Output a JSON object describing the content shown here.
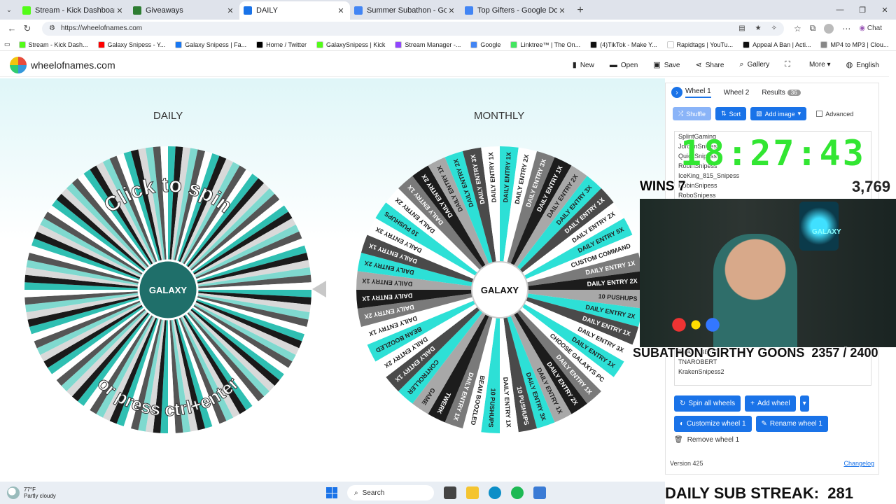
{
  "browser": {
    "tabs": [
      {
        "label": "Stream - Kick Dashboard",
        "color": "#53fc18",
        "active": false
      },
      {
        "label": "Giveaways",
        "color": "#2e7d32",
        "active": false
      },
      {
        "label": "DAILY",
        "color": "#1a73e8",
        "active": true
      },
      {
        "label": "Summer Subathon - Google Docs",
        "color": "#4285f4",
        "active": false
      },
      {
        "label": "Top Gifters - Google Docs",
        "color": "#4285f4",
        "active": false
      }
    ],
    "url": "https://wheelofnames.com",
    "chat_label": "Chat",
    "bookmarks": [
      {
        "label": "Stream - Kick Dash...",
        "color": "#53fc18"
      },
      {
        "label": "Galaxy Snipess - Y...",
        "color": "#ff0000"
      },
      {
        "label": "Galaxy Snipess | Fa...",
        "color": "#1877f2"
      },
      {
        "label": "Home / Twitter",
        "color": "#000000"
      },
      {
        "label": "GalaxySnipess | Kick",
        "color": "#53fc18"
      },
      {
        "label": "Stream Manager -...",
        "color": "#9146ff"
      },
      {
        "label": "Google",
        "color": "#4285f4"
      },
      {
        "label": "Linktree™ | The On...",
        "color": "#43e660"
      },
      {
        "label": "(4)TikTok - Make Y...",
        "color": "#111111"
      },
      {
        "label": "Rapidtags | YouTu...",
        "color": "#ffffff"
      },
      {
        "label": "Appeal A Ban | Acti...",
        "color": "#111111"
      },
      {
        "label": "MP4 to MP3 | Clou...",
        "color": "#888888"
      }
    ]
  },
  "site": {
    "logo": "wheelofnames.com",
    "nav": {
      "new": "New",
      "open": "Open",
      "save": "Save",
      "share": "Share",
      "gallery": "Gallery",
      "more": "More",
      "language": "English"
    }
  },
  "wheels": {
    "daily": {
      "title": "DAILY",
      "line1": "Click to spin",
      "line2": "or press ctrl+enter",
      "logo_text": "GALAXY",
      "colors": [
        "#2fbfb2",
        "#1a1a1a",
        "#d9d9d9",
        "#7fd9cf",
        "#555555",
        "#ffffff"
      ]
    },
    "monthly": {
      "title": "MONTHLY",
      "logo_text": "GALAXY",
      "segments": [
        "DAILY ENTRY 1X",
        "DAILY ENTRY 2X",
        "DAILY ENTRY 3X",
        "DAILY ENTRY 1X",
        "DAILY ENTRY 2X",
        "DAILY ENTRY 3X",
        "DAILY ENTRY 1X",
        "DAILY ENTRY 2X",
        "DAILY ENTRY 5X",
        "CUSTOM COMMAND",
        "DAILY ENTRY 1X",
        "DAILY ENTRY 2X",
        "10 PUSHUPS",
        "DAILY ENTRY 2X",
        "DAILY ENTRY 1X",
        "DAILY ENTRY 3X",
        "DAILY ENTRY 1X",
        "CHOOSE GALAXYS PC",
        "DAILY ENTRY 1X",
        "DAILY ENTRY 2X",
        "DAILY ENTRY 1X",
        "DAILY ENTRY 3X",
        "10 PUSHUPS",
        "DAILY ENTRY 1X",
        "10 PUSHUPS",
        "BEAN BOOZLED",
        "DAILY ENTRY 1X",
        "TWERK",
        "GAME",
        "CONTROLLER",
        "DAILY ENTRY 1X",
        "DAILY ENTRY 2X",
        "BEAN BOOZLED",
        "DAILY ENTRY 1X",
        "DAILY ENTRY 2X",
        "DAILY ENTRY 1X",
        "DAILY ENTRY 1X",
        "DAILY ENTRY 2X",
        "DAILY ENTRY 1X",
        "DAILY ENTRY 3X",
        "10 PUSHUPS",
        "DAILY ENTRY 2X",
        "DAILY ENTRY 1X",
        "DAILY ENTRY 2X",
        "DAILY ENTRY 1X",
        "DAILY ENTRY 2X",
        "DAILY ENTRY 3X",
        "DAILY ENTRY 1X"
      ],
      "colors": [
        "#2de0d6",
        "#ffffff",
        "#7a7a7a",
        "#1c1c1c",
        "#a8a8a8",
        "#2de0d6",
        "#4a4a4a",
        "#ffffff"
      ]
    }
  },
  "panel": {
    "tabs": {
      "wheel1": "Wheel 1",
      "wheel2": "Wheel 2",
      "results": "Results",
      "results_count": "36"
    },
    "shuffle": "Shuffle",
    "sort": "Sort",
    "add_image": "Add image",
    "advanced": "Advanced",
    "names": [
      "SplintGaming",
      "JordanSnipess",
      "QuickSnipess",
      "RobinSnipess",
      "IceKing_815_Snipess",
      "RobinSnipess",
      "RoboSnipess",
      "TNAROBERT",
      "TNAROBERT",
      "KrakenSnipess2"
    ],
    "spin_all": "Spin all wheels",
    "add_wheel": "Add wheel",
    "customize": "Customize wheel 1",
    "rename": "Rename wheel 1",
    "remove": "Remove wheel 1",
    "version": "Version 425",
    "changelog": "Changelog"
  },
  "overlay": {
    "timer": "18:27:43",
    "wins_label": "WINS",
    "wins_value": "7",
    "coins": "3,769",
    "cam_label": "GALAXY",
    "subathon": "SUBATHON GIRTHY GOONS",
    "subathon_progress": "2357 / 2400",
    "streak_label": "DAILY SUB STREAK:",
    "streak_value": "281"
  },
  "taskbar": {
    "temp": "77°F",
    "weather": "Partly cloudy",
    "search": "Search"
  }
}
